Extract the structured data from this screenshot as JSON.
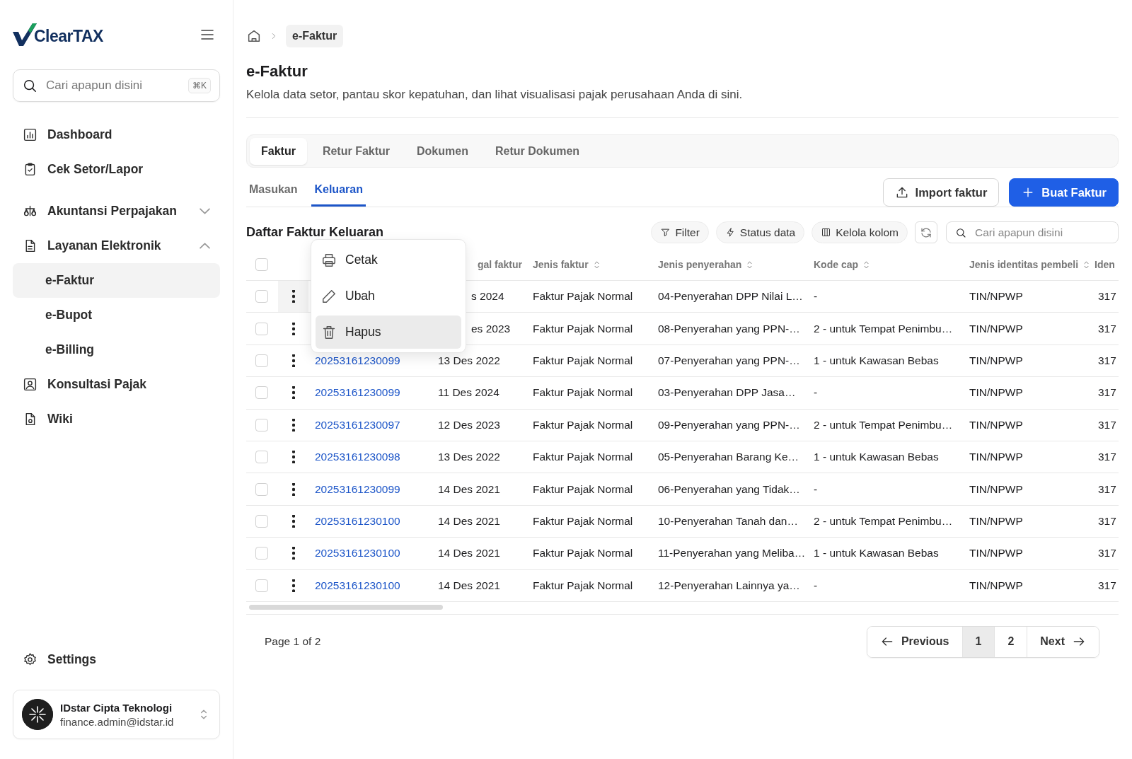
{
  "sidebar": {
    "logo": "ClearTAX",
    "search": {
      "placeholder": "Cari apapun disini",
      "shortcut": "⌘K"
    },
    "nav": [
      {
        "label": "Dashboard",
        "selected": false
      },
      {
        "label": "Cek Setor/Lapor",
        "selected": false
      },
      {
        "label": "Akuntansi Perpajakan",
        "selected": false,
        "expanded": false
      },
      {
        "label": "Layanan Elektronik",
        "selected": false,
        "expanded": true,
        "children": [
          {
            "label": "e-Faktur",
            "selected": true
          },
          {
            "label": "e-Bupot",
            "selected": false
          },
          {
            "label": "e-Billing",
            "selected": false
          }
        ]
      },
      {
        "label": "Konsultasi Pajak",
        "selected": false
      },
      {
        "label": "Wiki",
        "selected": false
      }
    ],
    "settings": "Settings",
    "account": {
      "name": "IDstar Cipta Teknologi",
      "email": "finance.admin@idstar.id"
    }
  },
  "breadcrumb": [
    "e-Faktur"
  ],
  "page": {
    "title": "e-Faktur",
    "description": "Kelola data setor, pantau skor kepatuhan, dan lihat visualisasi pajak perusahaan Anda di sini."
  },
  "tabs": [
    {
      "label": "Faktur",
      "selected": true
    },
    {
      "label": "Retur Faktur",
      "selected": false
    },
    {
      "label": "Dokumen",
      "selected": false
    },
    {
      "label": "Retur Dokumen",
      "selected": false
    }
  ],
  "sub_tabs": [
    {
      "label": "Masukan",
      "selected": false
    },
    {
      "label": "Keluaran",
      "selected": true
    }
  ],
  "actions": {
    "import": "Import faktur",
    "create": "Buat Faktur"
  },
  "list": {
    "title": "Daftar Faktur Keluaran",
    "filters": [
      "Filter",
      "Status data",
      "Kelola kolom"
    ],
    "search": {
      "placeholder": "Cari apapun disini"
    }
  },
  "table": {
    "select_all": {
      "checked": false
    },
    "columns": [
      "",
      "gal faktur",
      "Jenis faktur",
      "Jenis penyerahan",
      "Kode cap",
      "Jenis identitas pembeli",
      "Iden"
    ],
    "rows": [
      {
        "checked": false,
        "menu_open": true,
        "date": "s 2024",
        "type": "Faktur Pajak Normal",
        "delivery": "04-Penyerahan DPP Nilai L…",
        "stamp": "-",
        "id_type": "TIN/NPWP",
        "id": "317"
      },
      {
        "checked": false,
        "menu_open": false,
        "date": "es 2023",
        "type": "Faktur Pajak Normal",
        "delivery": "08-Penyerahan yang PPN-…",
        "stamp": "2 - untuk Tempat Penimbu…",
        "id_type": "TIN/NPWP",
        "id": "317"
      },
      {
        "checked": false,
        "menu_open": false,
        "number": "20253161230099",
        "date": "13 Des 2022",
        "type": "Faktur Pajak Normal",
        "delivery": "07-Penyerahan yang PPN-…",
        "stamp": "1 - untuk Kawasan Bebas",
        "id_type": "TIN/NPWP",
        "id": "317"
      },
      {
        "checked": false,
        "menu_open": false,
        "number": "20253161230099",
        "date": "11 Des 2024",
        "type": "Faktur Pajak Normal",
        "delivery": "03-Penyerahan DPP Jasa…",
        "stamp": "-",
        "id_type": "TIN/NPWP",
        "id": "317"
      },
      {
        "checked": false,
        "menu_open": false,
        "number": "20253161230097",
        "date": "12 Des 2023",
        "type": "Faktur Pajak Normal",
        "delivery": "09-Penyerahan yang PPN-…",
        "stamp": "2 - untuk Tempat Penimbu…",
        "id_type": "TIN/NPWP",
        "id": "317"
      },
      {
        "checked": false,
        "menu_open": false,
        "number": "20253161230098",
        "date": "13 Des 2022",
        "type": "Faktur Pajak Normal",
        "delivery": "05-Penyerahan Barang Ke…",
        "stamp": "1 - untuk Kawasan Bebas",
        "id_type": "TIN/NPWP",
        "id": "317"
      },
      {
        "checked": false,
        "menu_open": false,
        "number": "20253161230099",
        "date": "14 Des 2021",
        "type": "Faktur Pajak Normal",
        "delivery": "06-Penyerahan yang Tidak…",
        "stamp": "-",
        "id_type": "TIN/NPWP",
        "id": "317"
      },
      {
        "checked": false,
        "menu_open": false,
        "number": "20253161230100",
        "date": "14 Des 2021",
        "type": "Faktur Pajak Normal",
        "delivery": "10-Penyerahan Tanah dan…",
        "stamp": "2 - untuk Tempat Penimbu…",
        "id_type": "TIN/NPWP",
        "id": "317"
      },
      {
        "checked": false,
        "menu_open": false,
        "number": "20253161230100",
        "date": "14 Des 2021",
        "type": "Faktur Pajak Normal",
        "delivery": "11-Penyerahan yang Meliba…",
        "stamp": "1 - untuk Kawasan Bebas",
        "id_type": "TIN/NPWP",
        "id": "317"
      },
      {
        "checked": false,
        "menu_open": false,
        "number": "20253161230100",
        "date": "14 Des 2021",
        "type": "Faktur Pajak Normal",
        "delivery": "12-Penyerahan Lainnya ya…",
        "stamp": "-",
        "id_type": "TIN/NPWP",
        "id": "317"
      }
    ]
  },
  "row_menu": [
    {
      "label": "Cetak",
      "selected": false
    },
    {
      "label": "Ubah",
      "selected": false
    },
    {
      "label": "Hapus",
      "selected": true
    }
  ],
  "pagination": {
    "summary": "Page 1 of 2",
    "previous": "Previous",
    "pages": [
      {
        "label": "1",
        "selected": true
      },
      {
        "label": "2",
        "selected": false
      }
    ],
    "next": "Next"
  }
}
